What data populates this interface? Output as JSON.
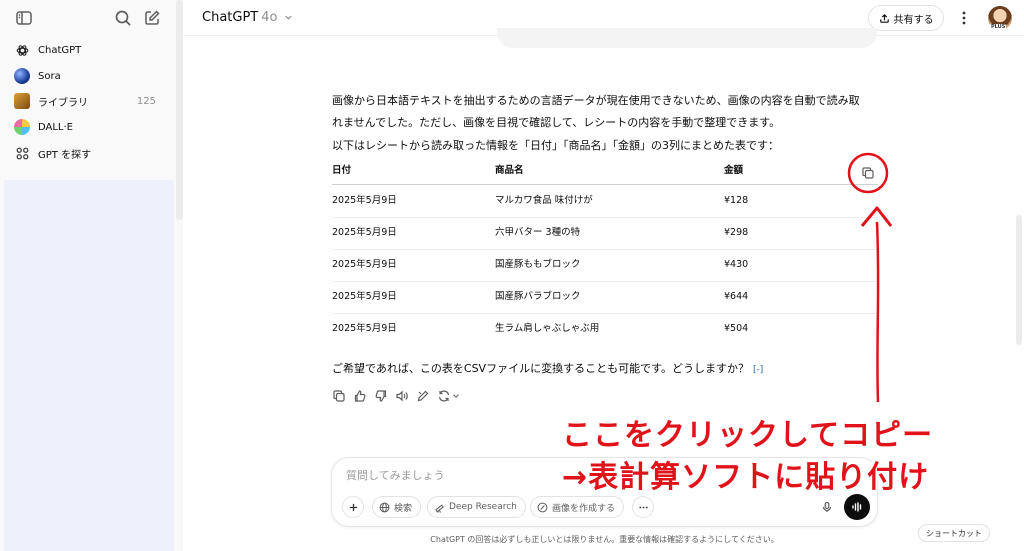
{
  "sidebar": {
    "items": [
      {
        "label": "ChatGPT",
        "count": ""
      },
      {
        "label": "Sora",
        "count": ""
      },
      {
        "label": "ライブラリ",
        "count": "125"
      },
      {
        "label": "DALL·E",
        "count": ""
      },
      {
        "label": "GPT を探す",
        "count": ""
      }
    ]
  },
  "header": {
    "model": "ChatGPT",
    "version": "4o",
    "share_label": "共有する",
    "avatar_badge": "PLUS"
  },
  "message": {
    "para1_line1": "画像から日本語テキストを抽出するための言語データが現在使用できないため、画像の内容を自動で読み取",
    "para1_line2": "れませんでした。ただし、画像を目視で確認して、レシートの内容を手動で整理できます。",
    "para2": "以下はレシートから読み取った情報を「日付」「商品名」「金額」の3列にまとめた表です：",
    "closing": "ご希望であれば、この表をCSVファイルに変換することも可能です。どうしますか？",
    "citation": "[-]"
  },
  "table": {
    "headers": [
      "日付",
      "商品名",
      "金額"
    ],
    "rows": [
      [
        "2025年5月9日",
        "マルカワ食品 味付けが",
        "¥128"
      ],
      [
        "2025年5月9日",
        "六甲バター 3種の特",
        "¥298"
      ],
      [
        "2025年5月9日",
        "国産豚ももブロック",
        "¥430"
      ],
      [
        "2025年5月9日",
        "国産豚バラブロック",
        "¥644"
      ],
      [
        "2025年5月9日",
        "生ラム肩しゃぶしゃぶ用",
        "¥504"
      ]
    ]
  },
  "composer": {
    "placeholder": "質問してみましょう",
    "search_label": "検索",
    "research_label": "Deep Research",
    "image_label": "画像を作成する"
  },
  "footer": {
    "disclaimer": "ChatGPT の回答は必ずしも正しいとは限りません。重要な情報は確認するようにしてください。",
    "shortcut_label": "ショートカット"
  },
  "annotation": {
    "line1": "ここをクリックしてコピー",
    "line2": "→表計算ソフトに貼り付け",
    "color": "#e1131a"
  }
}
